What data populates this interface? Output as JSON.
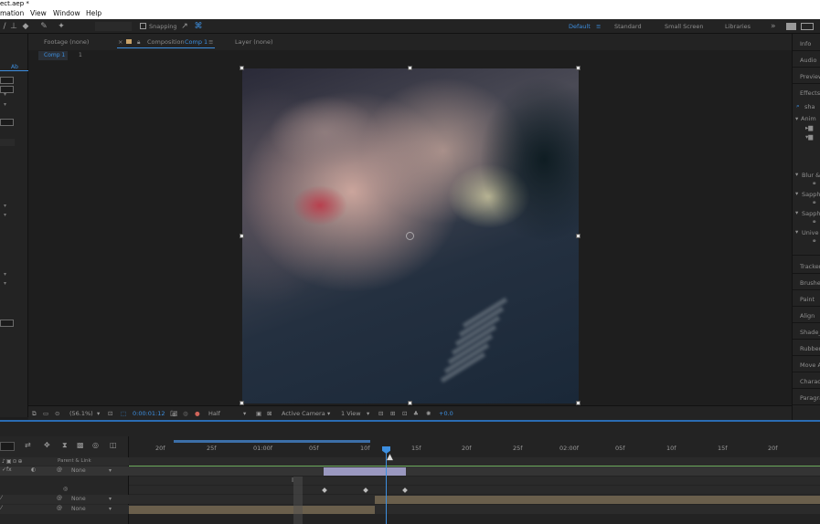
{
  "window": {
    "title": "ect.aep *"
  },
  "menu": [
    "mation",
    "View",
    "Window",
    "Help"
  ],
  "toolbar": {
    "snapping_label": "Snapping"
  },
  "workspaces": [
    "Default",
    "Standard",
    "Small Screen",
    "Libraries"
  ],
  "panel_tabs": {
    "footage": "Footage (none)",
    "composition": "Composition",
    "comp_name": "Comp 1",
    "layer": "Layer (none)"
  },
  "breadcrumbs": [
    "Comp 1",
    "1"
  ],
  "left_panel": {
    "label": "Ab"
  },
  "viewer_bar": {
    "zoom": "(56.1%)",
    "timecode": "0:00:01:12",
    "resolution": "Half",
    "camera": "Active Camera",
    "views": "1 View",
    "exposure": "+0.0"
  },
  "right_panel": {
    "top_items": [
      "Info",
      "Audio",
      "Preview",
      "Effects &",
      "sha"
    ],
    "tree_items": [
      "Anim"
    ],
    "effects_groups": [
      "Blur &",
      "Sapphi",
      "Sapphi",
      "Unive"
    ],
    "panels": [
      "Tracker",
      "Brushes",
      "Paint",
      "Align",
      "Shade_",
      "Rubber",
      "Move A",
      "Charact",
      "Paragra"
    ]
  },
  "timeline": {
    "header_label": "Parent & Link",
    "parent_value": "None",
    "ruler_labels": [
      "20f",
      "25f",
      "01:00f",
      "05f",
      "10f",
      "15f",
      "20f",
      "25f",
      "02:00f",
      "05f",
      "10f",
      "15f",
      "20f"
    ]
  },
  "colors": {
    "accent": "#3d8fe0",
    "clip": "#9a98c0"
  }
}
